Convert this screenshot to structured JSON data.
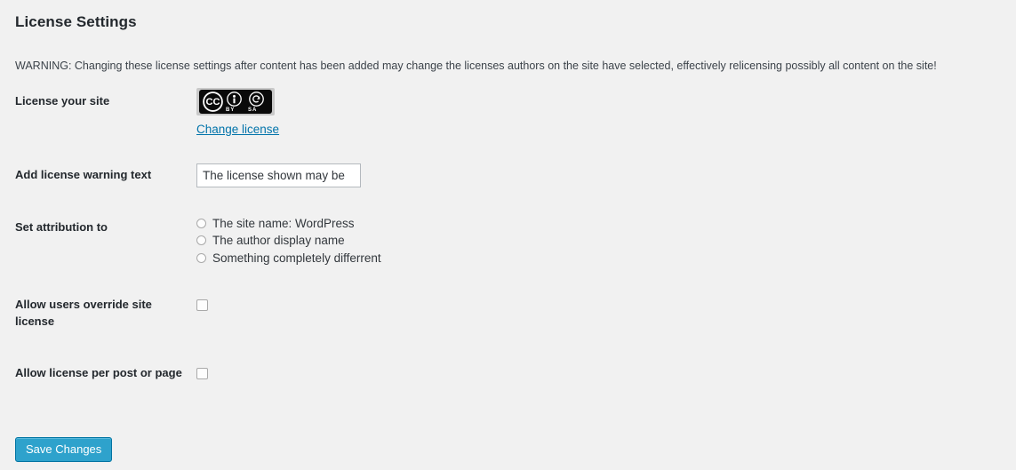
{
  "page": {
    "title": "License Settings",
    "warning": "WARNING: Changing these license settings after content has been added may change the licenses authors on the site have selected, effectively relicensing possibly all content on the site!"
  },
  "fields": {
    "license_site": {
      "label": "License your site",
      "badge": {
        "alt": "CC BY-SA license badge",
        "mark": "cc-icon",
        "attribution_icon": "cc-by-icon",
        "sharealike_icon": "cc-sa-icon",
        "attribution_caption": "BY",
        "sharealike_caption": "SA"
      },
      "change_link": "Change license"
    },
    "warning_text": {
      "label": "Add license warning text",
      "value": "The license shown may be",
      "placeholder": ""
    },
    "attribution": {
      "label": "Set attribution to",
      "options": [
        {
          "label": "The site name: WordPress",
          "selected": false
        },
        {
          "label": "The author display name",
          "selected": false
        },
        {
          "label": "Something completely differrent",
          "selected": false
        }
      ]
    },
    "override": {
      "label": "Allow users override site license",
      "checked": false
    },
    "per_post": {
      "label": "Allow license per post or page",
      "checked": false
    }
  },
  "submit": {
    "save_label": "Save Changes"
  },
  "colors": {
    "background": "#f1f1f1",
    "title": "#23282d",
    "link": "#0073aa",
    "button": "#2ea2cc",
    "button_border": "#0074a2",
    "input_border": "#b4b9be",
    "badge_dark": "#0a0a0a",
    "badge_frame": "#c9c9c9"
  }
}
